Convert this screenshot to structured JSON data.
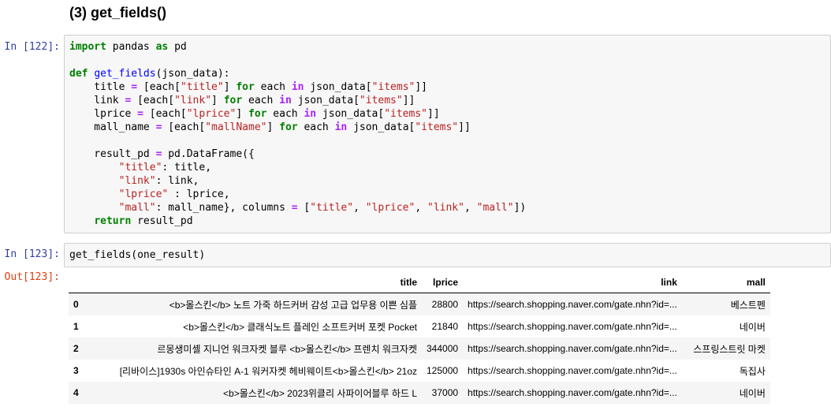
{
  "markdown": {
    "heading": "(3) get_fields()"
  },
  "cells": [
    {
      "prompt": "In [122]:",
      "code_lines": [
        "import pandas as pd",
        "",
        "def get_fields(json_data):",
        "    title = [each[\"title\"] for each in json_data[\"items\"]]",
        "    link = [each[\"link\"] for each in json_data[\"items\"]]",
        "    lprice = [each[\"lprice\"] for each in json_data[\"items\"]]",
        "    mall_name = [each[\"mallName\"] for each in json_data[\"items\"]]",
        "",
        "    result_pd = pd.DataFrame({",
        "        \"title\": title,",
        "        \"link\": link,",
        "        \"lprice\" : lprice,",
        "        \"mall\": mall_name}, columns = [\"title\", \"lprice\", \"link\", \"mall\"])",
        "    return result_pd"
      ]
    },
    {
      "prompt": "In [123]:",
      "code_lines": [
        "get_fields(one_result)"
      ]
    }
  ],
  "output": {
    "prompt": "Out[123]:",
    "columns": [
      "",
      "title",
      "lprice",
      "link",
      "mall"
    ],
    "rows": [
      [
        "0",
        "<b>몰스킨</b> 노트 가죽 하드커버 감성 고급 업무용 이쁜 심플",
        "28800",
        "https://search.shopping.naver.com/gate.nhn?id=...",
        "베스트펜"
      ],
      [
        "1",
        "<b>몰스킨</b> 클래식노트 플레인 소프트커버 포켓 Pocket",
        "21840",
        "https://search.shopping.naver.com/gate.nhn?id=...",
        "네이버"
      ],
      [
        "2",
        "르몽생미셸 지니언 워크자켓 블루 <b>몰스킨</b> 프렌치 워크자켓",
        "344000",
        "https://search.shopping.naver.com/gate.nhn?id=...",
        "스프링스트릿 마켓"
      ],
      [
        "3",
        "[리바이스]1930s 아인슈타인 A-1 워커자켓 헤비웨이트<b>몰스킨</b> 21oz",
        "125000",
        "https://search.shopping.naver.com/gate.nhn?id=...",
        "독집사"
      ],
      [
        "4",
        "<b>몰스킨</b> 2023위클리 사파이어블루 하드 L",
        "37000",
        "https://search.shopping.naver.com/gate.nhn?id=...",
        "네이버"
      ]
    ]
  }
}
